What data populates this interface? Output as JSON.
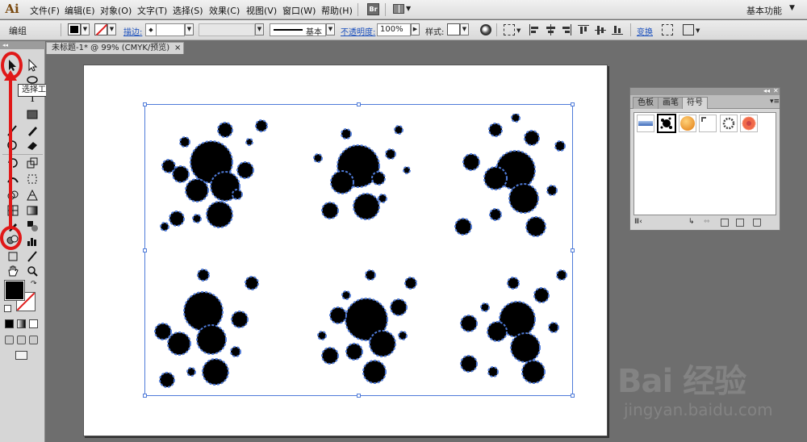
{
  "app": {
    "logo": "Ai"
  },
  "menubar": {
    "items": [
      "文件(F)",
      "编辑(E)",
      "对象(O)",
      "文字(T)",
      "选择(S)",
      "效果(C)",
      "视图(V)",
      "窗口(W)",
      "帮助(H)"
    ],
    "bridge_label": "Br",
    "workspace": "基本功能"
  },
  "controlbar": {
    "selection_label": "编组",
    "stroke_label": "描边:",
    "stroke_style": "基本",
    "opacity_label": "不透明度:",
    "opacity_value": "100%",
    "style_label": "样式:",
    "transform_label": "变换"
  },
  "document": {
    "tab_title": "未标题-1* @ 99% (CMYK/预览)",
    "close_glyph": "×"
  },
  "tools": {
    "tooltip": "选择工具 (V)"
  },
  "symbols_panel": {
    "tabs": [
      "色板",
      "画笔",
      "符号"
    ],
    "active_tab": "符号"
  },
  "colors": {
    "selection": "#4f7bd9",
    "annotation": "#e01818",
    "fill": "#000000"
  },
  "watermark": {
    "logo": "Bai 经验",
    "url": "jingyan.baidu.com"
  }
}
